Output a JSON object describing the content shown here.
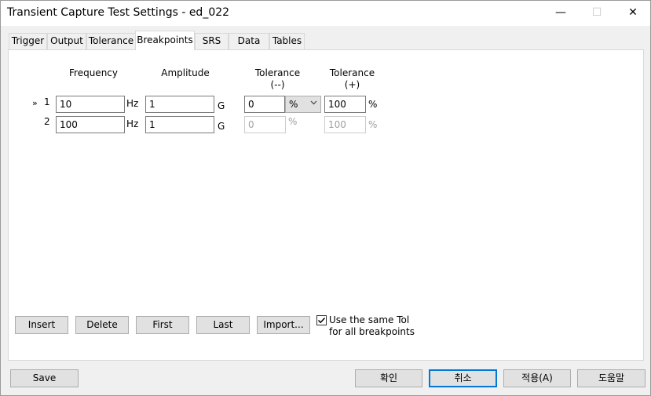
{
  "window": {
    "title": "Transient Capture Test Settings - ed_022",
    "minimize_glyph": "—",
    "maximize_glyph": "☐",
    "close_glyph": "✕"
  },
  "tabs": [
    {
      "label": "Trigger"
    },
    {
      "label": "Output"
    },
    {
      "label": "Tolerance"
    },
    {
      "label": "Breakpoints",
      "active": true
    },
    {
      "label": "SRS"
    },
    {
      "label": "Data"
    },
    {
      "label": "Tables"
    }
  ],
  "breakpoints": {
    "headers": {
      "frequency": "Frequency",
      "amplitude": "Amplitude",
      "tol_minus_line1": "Tolerance",
      "tol_minus_line2": "(--)",
      "tol_plus_line1": "Tolerance",
      "tol_plus_line2": "(+)"
    },
    "current_row_marker": "»",
    "rows": [
      {
        "index": "1",
        "frequency": "10",
        "freq_unit": "Hz",
        "amplitude": "1",
        "amp_unit": "G",
        "tol_minus": "0",
        "tol_minus_unit": "%",
        "tol_plus": "100",
        "tol_plus_unit": "%"
      },
      {
        "index": "2",
        "frequency": "100",
        "freq_unit": "Hz",
        "amplitude": "1",
        "amp_unit": "G",
        "tol_minus": "0",
        "tol_minus_unit": "%",
        "tol_plus": "100",
        "tol_plus_unit": "%"
      }
    ]
  },
  "actions": {
    "insert": "Insert",
    "delete": "Delete",
    "first": "First",
    "last": "Last",
    "import": "Import...",
    "same_tol_line1": "Use the same Tol",
    "same_tol_line2": "for all breakpoints",
    "same_tol_checked": true
  },
  "footer": {
    "save": "Save",
    "ok": "확인",
    "cancel": "취소",
    "apply": "적용(A)",
    "help": "도움말"
  }
}
